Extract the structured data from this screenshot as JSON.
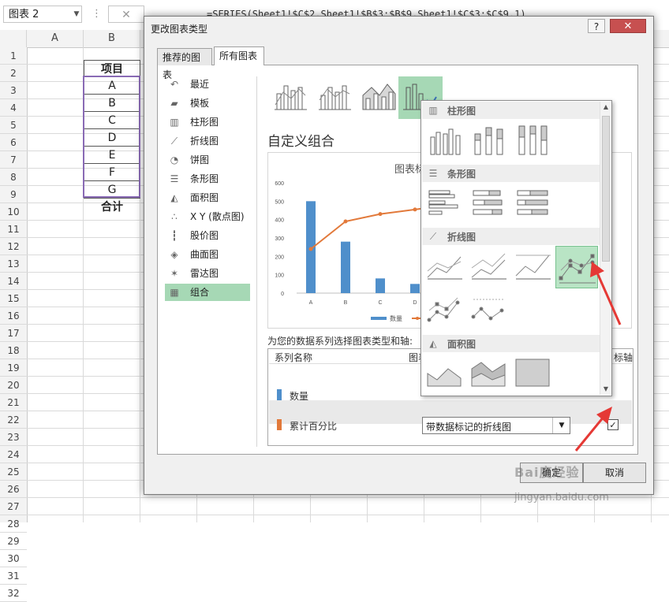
{
  "formula_bar": {
    "name_box": "图表 2",
    "cancel_glyph": "✕",
    "formula": "=SERIES(Sheet1!$C$2,Sheet1!$B$3:$B$9,Sheet1!$C$3:$C$9,1)"
  },
  "columns": [
    "A",
    "B"
  ],
  "rows": [
    "1",
    "2",
    "3",
    "4",
    "5",
    "6",
    "7",
    "8",
    "9",
    "10",
    "11",
    "12",
    "13",
    "14",
    "15",
    "16",
    "17",
    "18",
    "19",
    "20",
    "21",
    "22",
    "23",
    "24",
    "25",
    "26",
    "27",
    "28",
    "29",
    "30",
    "31",
    "32"
  ],
  "cells": {
    "header": "项目",
    "items": [
      "A",
      "B",
      "C",
      "D",
      "E",
      "F",
      "G"
    ],
    "total": "合计"
  },
  "dialog": {
    "title": "更改图表类型",
    "help": "?",
    "close": "✕",
    "tabs": {
      "recommended": "推荐的图表",
      "all": "所有图表"
    },
    "chart_types": [
      {
        "icon": "↶",
        "label": "最近"
      },
      {
        "icon": "▰",
        "label": "模板"
      },
      {
        "icon": "▥",
        "label": "柱形图"
      },
      {
        "icon": "⟋",
        "label": "折线图"
      },
      {
        "icon": "◔",
        "label": "饼图"
      },
      {
        "icon": "☰",
        "label": "条形图"
      },
      {
        "icon": "◭",
        "label": "面积图"
      },
      {
        "icon": "∴",
        "label": "X Y (散点图)"
      },
      {
        "icon": "┇",
        "label": "股价图"
      },
      {
        "icon": "◈",
        "label": "曲面图"
      },
      {
        "icon": "✶",
        "label": "雷达图"
      },
      {
        "icon": "▦",
        "label": "组合"
      }
    ],
    "combo_title": "自定义组合",
    "preview_title": "图表标",
    "series_prompt": "为您的数据系列选择图表类型和轴:",
    "series_headers": {
      "name": "系列名称",
      "type": "图表",
      "axis": "标轴"
    },
    "series": [
      {
        "name": "数量",
        "color": "#4f8fcb"
      },
      {
        "name": "累计百分比",
        "color": "#e2793a",
        "type": "带数据标记的折线图",
        "secondary_checked": "✓"
      }
    ],
    "ok": "确定",
    "cancel": "取消"
  },
  "gallery": {
    "sections": [
      {
        "icon": "▥",
        "label": "柱形图"
      },
      {
        "icon": "☰",
        "label": "条形图"
      },
      {
        "icon": "⟋",
        "label": "折线图"
      },
      {
        "icon": "◭",
        "label": "面积图"
      }
    ],
    "scroll_up": "▲",
    "scroll_down": "▼"
  },
  "colors": {
    "accent_green": "#a6d8b5",
    "bar": "#4f8fcb",
    "line": "#e2793a",
    "arrow": "#e53935"
  },
  "chart_data": {
    "type": "bar",
    "title": "",
    "categories": [
      "A",
      "B",
      "C",
      "D"
    ],
    "series": [
      {
        "name": "数量",
        "type": "bar",
        "values": [
          500,
          280,
          80,
          50
        ]
      },
      {
        "type": "line",
        "values": [
          240,
          390,
          430,
          455
        ]
      }
    ],
    "ylim": [
      0,
      600
    ],
    "yticks": [
      0,
      100,
      200,
      300,
      400,
      500,
      600
    ],
    "legend": "bottom",
    "grid": false
  },
  "watermark": {
    "main": "Bai度经验",
    "url": "jingyan.baidu.com"
  }
}
